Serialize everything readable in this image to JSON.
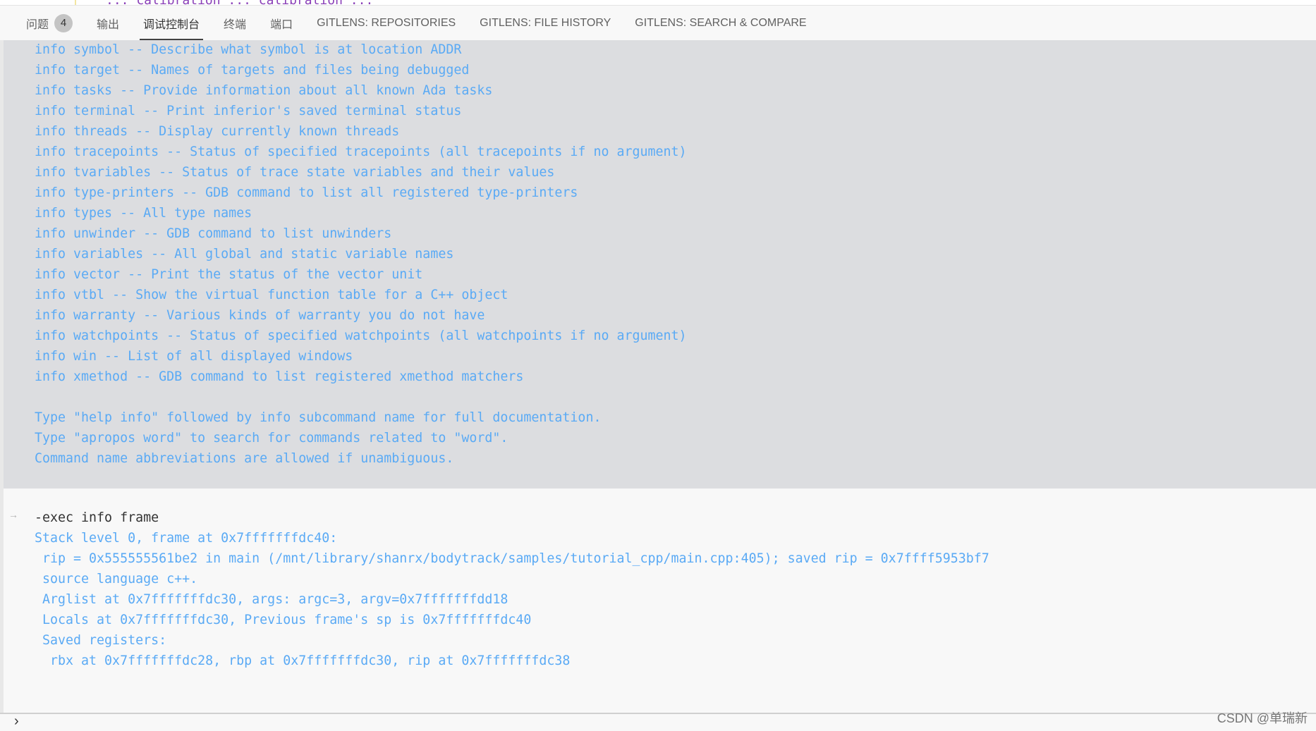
{
  "panel_tabs": [
    {
      "label": "问题",
      "badge": "4"
    },
    {
      "label": "输出"
    },
    {
      "label": "调试控制台",
      "active": true
    },
    {
      "label": "终端"
    },
    {
      "label": "端口"
    },
    {
      "label": "GITLENS: REPOSITORIES"
    },
    {
      "label": "GITLENS: FILE HISTORY"
    },
    {
      "label": "GITLENS: SEARCH & COMPARE"
    }
  ],
  "help_output": [
    "info symbol -- Describe what symbol is at location ADDR",
    "info target -- Names of targets and files being debugged",
    "info tasks -- Provide information about all known Ada tasks",
    "info terminal -- Print inferior's saved terminal status",
    "info threads -- Display currently known threads",
    "info tracepoints -- Status of specified tracepoints (all tracepoints if no argument)",
    "info tvariables -- Status of trace state variables and their values",
    "info type-printers -- GDB command to list all registered type-printers",
    "info types -- All type names",
    "info unwinder -- GDB command to list unwinders",
    "info variables -- All global and static variable names",
    "info vector -- Print the status of the vector unit",
    "info vtbl -- Show the virtual function table for a C++ object",
    "info warranty -- Various kinds of warranty you do not have",
    "info watchpoints -- Status of specified watchpoints (all watchpoints if no argument)",
    "info win -- List of all displayed windows",
    "info xmethod -- GDB command to list registered xmethod matchers",
    "",
    "Type \"help info\" followed by info subcommand name for full documentation.",
    "Type \"apropos word\" to search for commands related to \"word\".",
    "Command name abbreviations are allowed if unambiguous."
  ],
  "command": "-exec info frame",
  "frame_output": [
    "Stack level 0, frame at 0x7fffffffdc40:",
    " rip = 0x555555561be2 in main (/mnt/library/shanrx/bodytrack/samples/tutorial_cpp/main.cpp:405); saved rip = 0x7ffff5953bf7",
    " source language c++.",
    " Arglist at 0x7fffffffdc30, args: argc=3, argv=0x7fffffffdd18",
    " Locals at 0x7fffffffdc30, Previous frame's sp is 0x7fffffffdc40",
    " Saved registers:",
    "  rbx at 0x7fffffffdc28, rbp at 0x7fffffffdc30, rip at 0x7fffffffdc38"
  ],
  "prompt_icon": "chevron-right-icon",
  "watermark": "CSDN @单瑞新",
  "colors": {
    "output": "#5aaaf5",
    "command": "#333333",
    "output_bg": "#dcdde0"
  }
}
